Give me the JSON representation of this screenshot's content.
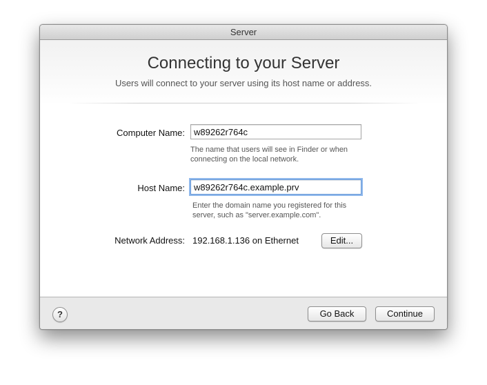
{
  "window": {
    "title": "Server"
  },
  "header": {
    "heading": "Connecting to your Server",
    "subheading": "Users will connect to your server using its host name or address."
  },
  "form": {
    "computer_name": {
      "label": "Computer Name:",
      "value": "w89262r764c",
      "hint_line1": "The name that users will see in Finder or when",
      "hint_line2": "connecting on the local network."
    },
    "host_name": {
      "label": "Host Name:",
      "value": "w89262r764c.example.prv",
      "hint_line1": "Enter the domain name you registered for this",
      "hint_line2": "server, such as \"server.example.com\"."
    },
    "network_address": {
      "label": "Network Address:",
      "value": "192.168.1.136 on Ethernet",
      "edit_label": "Edit..."
    }
  },
  "footer": {
    "help_label": "?",
    "back_label": "Go Back",
    "continue_label": "Continue"
  }
}
